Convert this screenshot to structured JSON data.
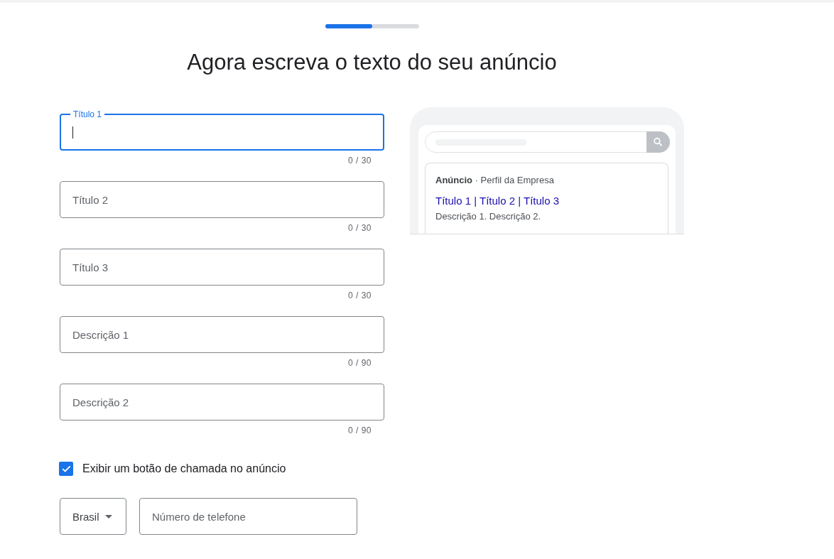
{
  "progress": {
    "level": 0.5
  },
  "heading": "Agora escreva o texto do seu anúncio",
  "fields": [
    {
      "label": "Título 1",
      "focused": true,
      "counter": "0 / 30"
    },
    {
      "label": "Título 2",
      "focused": false,
      "counter": "0 / 30"
    },
    {
      "label": "Título 3",
      "focused": false,
      "counter": "0 / 30"
    },
    {
      "label": "Descrição 1",
      "focused": false,
      "counter": "0 / 90"
    },
    {
      "label": "Descrição 2",
      "focused": false,
      "counter": "0 / 90"
    }
  ],
  "call_button": {
    "label": "Exibir um botão de chamada no anúncio",
    "checked": true
  },
  "country_select": {
    "value": "Brasil"
  },
  "phone_field": {
    "placeholder": "Número de telefone"
  },
  "preview": {
    "attribution": "**Anúncio** · Perfil da Empresa",
    "headline": "Título 1 | Título 2 | Título 3",
    "description": "Descrição 1. Descrição 2."
  }
}
